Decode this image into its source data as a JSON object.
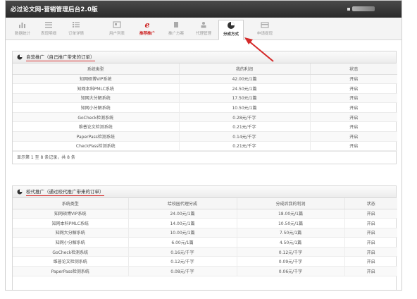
{
  "app": {
    "title": "必过论文网-营销管理后台2.0版"
  },
  "toolbar": {
    "items": [
      {
        "label": "数据统计",
        "icon": "bar-chart-icon"
      },
      {
        "label": "表现明细",
        "icon": "list-icon"
      },
      {
        "label": "订单详情",
        "icon": "orders-icon"
      },
      {
        "label": "用户列表",
        "icon": "user-list-icon"
      },
      {
        "label": "推荐推广",
        "icon": "ie-promote-icon"
      },
      {
        "label": "推广方案",
        "icon": "plan-icon"
      },
      {
        "label": "代理管理",
        "icon": "agent-icon"
      },
      {
        "label": "分成方式",
        "icon": "pie-chart-icon"
      },
      {
        "label": "申请提现",
        "icon": "withdraw-icon"
      }
    ],
    "active_label": "分成方式"
  },
  "self_promo": {
    "heading": "自营推广",
    "heading_note": "（自己推广带来的订单）",
    "columns": [
      "系统类型",
      "我的利润",
      "状态"
    ],
    "rows": [
      [
        "知网硕博VIP系统",
        "42.00元/1篇",
        "开启"
      ],
      [
        "知网本科PMLC系统",
        "24.50元/1篇",
        "开启"
      ],
      [
        "知网大分解系统",
        "17.50元/1篇",
        "开启"
      ],
      [
        "知网小分解系统",
        "10.50元/1篇",
        "开启"
      ],
      [
        "GoCheck检测系统",
        "0.28元/千字",
        "开启"
      ],
      [
        "维普论文检测系统",
        "0.21元/千字",
        "开启"
      ],
      [
        "PaperPass检测系统",
        "0.14元/千字",
        "开启"
      ],
      [
        "CheckPass检测系统",
        "0.21元/千字",
        "开启"
      ]
    ],
    "pager": "显示第 1 至 8 条记录，共 8 条"
  },
  "school_promo": {
    "heading": "校代推广",
    "heading_note": "（通过校代推广带来的订单）",
    "columns": [
      "系统类型",
      "给校园代理分成",
      "分成后我的利润",
      "状态"
    ],
    "rows": [
      [
        "知网硕博VIP系统",
        "24.00元/1篇",
        "18.00元/1篇",
        "开启"
      ],
      [
        "知网本科PMLC系统",
        "14.00元/1篇",
        "10.50元/1篇",
        "开启"
      ],
      [
        "知网大分解系统",
        "10.00元/1篇",
        "7.50元/1篇",
        "开启"
      ],
      [
        "知网小分解系统",
        "6.00元/1篇",
        "4.50元/1篇",
        "开启"
      ],
      [
        "GoCheck检测系统",
        "0.16元/千字",
        "0.12元/千字",
        "开启"
      ],
      [
        "维普论文检测系统",
        "0.12元/千字",
        "0.09元/千字",
        "开启"
      ],
      [
        "PaperPass检测系统",
        "0.08元/千字",
        "0.06元/千字",
        "开启"
      ]
    ]
  },
  "colors": {
    "accent_red": "#cc2222",
    "titlebar": "#333333"
  }
}
